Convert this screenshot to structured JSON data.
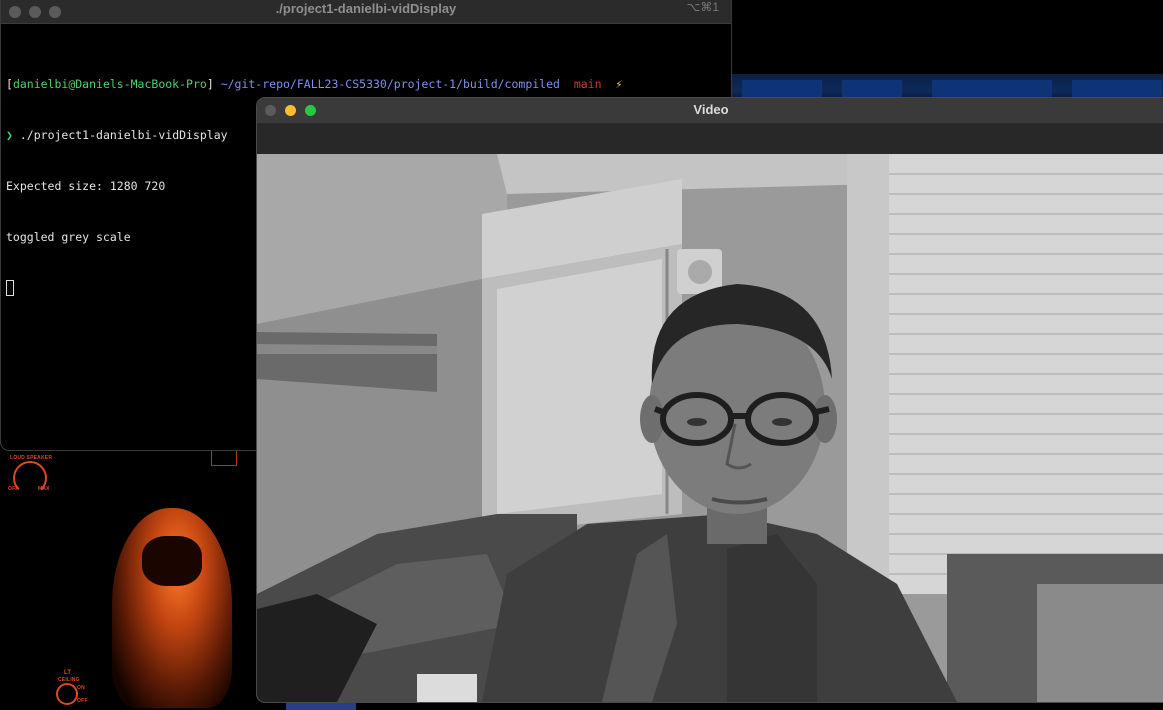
{
  "terminal": {
    "title": "./project1-danielbi-vidDisplay",
    "shortcut": "⌥⌘1",
    "prompt": {
      "open_bracket": "[",
      "user_host": "danielbi@Daniels-MacBook-Pro",
      "close_bracket": "]",
      "path": "~/git-repo/FALL23-CS5330/project-1/build/compiled",
      "branch": "main",
      "status_glyph": "⚡"
    },
    "command_prefix": "❯",
    "command": "./project1-danielbi-vidDisplay",
    "output": [
      "Expected size: 1280 720",
      "toggled grey scale"
    ]
  },
  "video_window": {
    "title": "Video"
  },
  "desktop": {
    "console_labels": {
      "speaker": "LOUD SPEAKER",
      "speaker_off": "OFF",
      "speaker_max": "MAX",
      "lt": "LT",
      "ceiling": "CEILING",
      "on": "ON",
      "off": "OFF"
    }
  },
  "colors": {
    "traffic_close": "#fe5f57",
    "traffic_minimize": "#febc2e",
    "traffic_zoom": "#28c840",
    "terminal_green": "#4fd16b",
    "terminal_blue": "#7e8ff0",
    "terminal_red": "#d7362b"
  }
}
